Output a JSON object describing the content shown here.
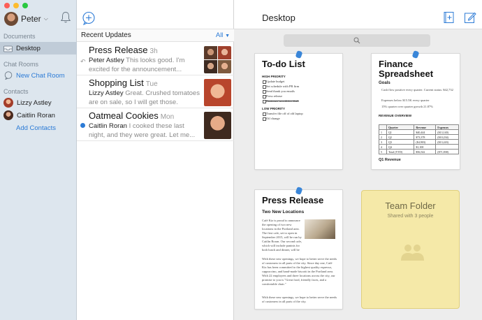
{
  "sidebar": {
    "user_name": "Peter",
    "sections": {
      "documents": "Documents",
      "chat_rooms": "Chat Rooms",
      "contacts": "Contacts"
    },
    "items": {
      "desktop": "Desktop",
      "new_chat_room": "New Chat Room",
      "lizzy": "Lizzy Astley",
      "caitlin": "Caitlin Roran",
      "add_contacts": "Add Contacts"
    }
  },
  "updates": {
    "header": "Recent Updates",
    "filter": "All",
    "conversations": [
      {
        "title": "Press Release",
        "time": "3h",
        "sender": "Peter Astley",
        "preview": "This looks good. I'm excited for the announcement..."
      },
      {
        "title": "Shopping List",
        "time": "Tue",
        "sender": "Lizzy Astley",
        "preview": "Great. Crushed tomatoes are on sale, so I will get those."
      },
      {
        "title": "Oatmeal Cookies",
        "time": "Mon",
        "sender": "Caitlin Roran",
        "preview": "I cooked these last night, and they were great. Let me..."
      }
    ]
  },
  "main": {
    "title": "Desktop",
    "todo": {
      "title": "To-do List",
      "high_priority": "HIGH PRIORITY",
      "high_items": [
        "Update budget",
        "Set schedule with PR firm",
        "Send thank you emails",
        "Press release",
        "Customer newsletter draft"
      ],
      "low_priority": "LOW PRIORITY",
      "low_items": [
        "Transfer file off of old laptop",
        "Oil change"
      ]
    },
    "finance": {
      "title_line1": "Finance",
      "title_line2": "Spreadsheet",
      "goals_label": "Goals",
      "goals": [
        "Cash flow positive every quarter. Current status: $42,732",
        "Expenses below $15.5K every quarter",
        "15% quarter over quarter growth 21.87%"
      ],
      "revenue_overview": "REVENUE OVERVIEW",
      "table_headers": [
        "",
        "Quarter",
        "Revenue",
        "Expenses"
      ],
      "table_rows": [
        [
          "1",
          "Q1",
          "$40,444",
          "($13,140)"
        ],
        [
          "2",
          "Q2",
          "$73,378",
          "($10,234)"
        ],
        [
          "3",
          "Q3",
          "($4,903)",
          "($13,243)"
        ],
        [
          "4",
          "Q4",
          "$1,100",
          ""
        ],
        [
          "5",
          "Total (YTD)",
          "$56,542",
          "($71,838)"
        ]
      ],
      "q1_revenue": "Q1 Revenue"
    },
    "press": {
      "title": "Press Release",
      "subtitle": "Two New Locations",
      "para1": "Café Kiz is proud to announce the opening of two new locations in the Portland area. The first cafe, set to open in September 2015, will be run by Caitlin Roran. Our second cafe, which will include paninis for both lunch and dinner, will be run by Lizzy Astley.",
      "para2": "With these new openings, we hope to better serve the needs of customers in all parts of the city. Since day one, Café Kiz has been committed to the highest quality espresso, cappuccino, and hand-made biscotti in the Portland area. With 22 employees and three locations across the city, our promise to you is \"Great food, friendly faces, and a comfortable chair.\"",
      "para3": "With these new openings, we hope to better serve the needs of customers in all parts of the city."
    },
    "team_folder": {
      "title": "Team Folder",
      "subtitle": "Shared with 3 people"
    }
  }
}
